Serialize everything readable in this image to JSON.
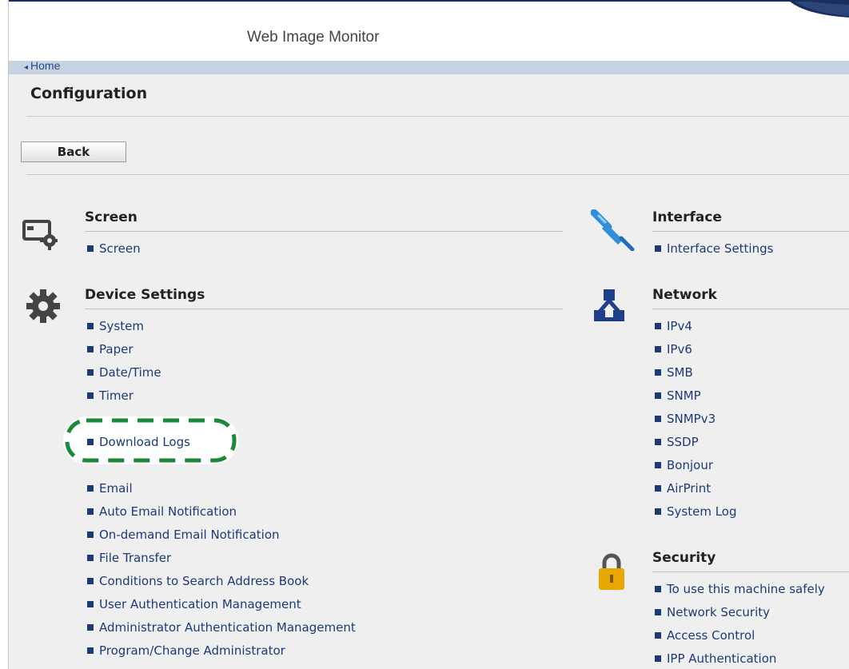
{
  "header": {
    "app_title": "Web Image Monitor"
  },
  "breadcrumb": {
    "home": "Home"
  },
  "page": {
    "title": "Configuration",
    "back_label": "Back"
  },
  "sections": {
    "screen": {
      "title": "Screen",
      "icon": "screen-settings-icon",
      "items": [
        "Screen"
      ]
    },
    "device_settings": {
      "title": "Device Settings",
      "icon": "gear-icon",
      "items": [
        "System",
        "Paper",
        "Date/Time",
        "Timer",
        "Download Logs",
        "Email",
        "Auto Email Notification",
        "On-demand Email Notification",
        "File Transfer",
        "Conditions to Search Address Book",
        "User Authentication Management",
        "Administrator Authentication Management",
        "Program/Change Administrator"
      ]
    },
    "interface": {
      "title": "Interface",
      "icon": "cable-plug-icon",
      "items": [
        "Interface Settings"
      ]
    },
    "network": {
      "title": "Network",
      "icon": "network-icon",
      "items": [
        "IPv4",
        "IPv6",
        "SMB",
        "SNMP",
        "SNMPv3",
        "SSDP",
        "Bonjour",
        "AirPrint",
        "System Log"
      ]
    },
    "security": {
      "title": "Security",
      "icon": "padlock-icon",
      "items": [
        "To use this machine safely",
        "Network Security",
        "Access Control",
        "IPP Authentication"
      ]
    }
  },
  "colors": {
    "link": "#1d3a78",
    "home_bar": "#c7d2e3",
    "highlight_dash": "#1a8a3a",
    "interface_icon": "#2f8fd8",
    "network_icon": "#1f3f8a",
    "lock_icon": "#e8a800"
  }
}
